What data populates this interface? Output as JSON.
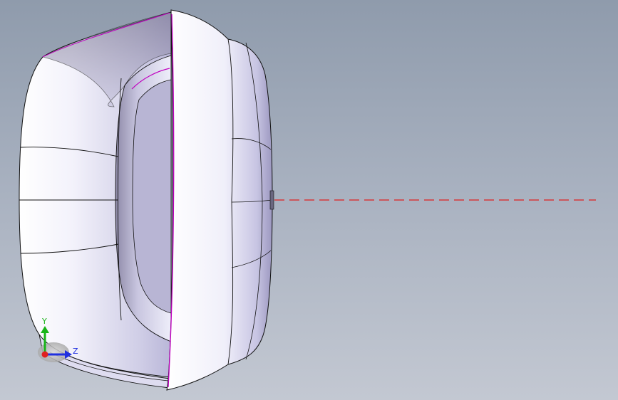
{
  "viewport": {
    "background_top": "#8f9bac",
    "background_bottom": "#c3c8d2"
  },
  "model": {
    "surface_color": "#e6e4f6",
    "edge_color": "#111111",
    "highlight_edge_color": "#c000c0"
  },
  "centerline": {
    "color": "#e02020",
    "style": "dashed"
  },
  "triad": {
    "y_label": "Y",
    "z_label": "Z",
    "y_color": "#18b418",
    "z_color": "#2030e0",
    "origin_color": "#e02020"
  }
}
